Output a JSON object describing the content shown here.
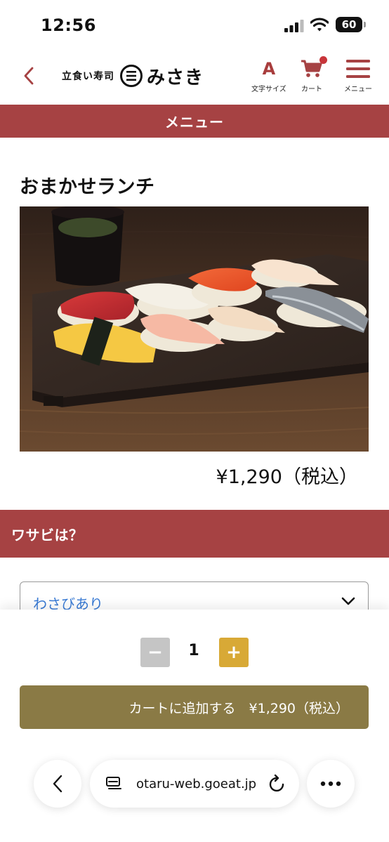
{
  "status_bar": {
    "time": "12:56",
    "battery": "60"
  },
  "header": {
    "logo_small": "立食い寿司",
    "logo_big": "みさき",
    "font_size_label": "文字サイズ",
    "font_size_letter": "A",
    "cart_label": "カート",
    "menu_label": "メニュー"
  },
  "menu_bar": {
    "title": "メニュー"
  },
  "product": {
    "name": "おまかせランチ",
    "price": "¥1,290（税込）"
  },
  "option": {
    "question": "ワサビは？",
    "selected": "わさびあり"
  },
  "quantity": {
    "minus": "−",
    "value": "1",
    "plus": "+"
  },
  "add_to_cart": {
    "label": "カートに追加する　¥1,290（税込）"
  },
  "browser": {
    "url": "otaru-web.goeat.jp"
  },
  "colors": {
    "accent": "#a64243",
    "gold": "#8a7a45",
    "plus": "#d8a936",
    "link": "#3a7bd5"
  }
}
